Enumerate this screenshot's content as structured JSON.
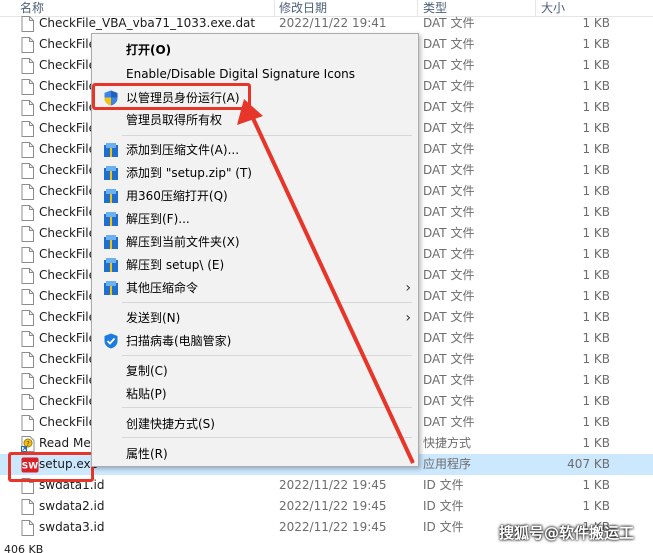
{
  "columns": {
    "name": "名称",
    "date": "修改日期",
    "type": "类型",
    "size": "大小"
  },
  "files": [
    {
      "name": "CheckFile_VBA_vba71_1033.exe.dat",
      "date": "2022/11/22 19:41",
      "type": "DAT 文件",
      "size": "1 KB",
      "icon": "doc-icon"
    },
    {
      "name": "CheckFile",
      "date": "",
      "type": "DAT 文件",
      "size": "1 KB",
      "icon": "doc-icon"
    },
    {
      "name": "CheckFile",
      "date": "",
      "type": "DAT 文件",
      "size": "1 KB",
      "icon": "doc-icon"
    },
    {
      "name": "CheckFile",
      "date": "",
      "type": "DAT 文件",
      "size": "1 KB",
      "icon": "doc-icon"
    },
    {
      "name": "CheckFile",
      "date": "",
      "type": "DAT 文件",
      "size": "1 KB",
      "icon": "doc-icon"
    },
    {
      "name": "CheckFile",
      "date": "",
      "type": "DAT 文件",
      "size": "1 KB",
      "icon": "doc-icon"
    },
    {
      "name": "CheckFile",
      "date": "",
      "type": "DAT 文件",
      "size": "1 KB",
      "icon": "doc-icon"
    },
    {
      "name": "CheckFile",
      "date": "",
      "type": "DAT 文件",
      "size": "1 KB",
      "icon": "doc-icon"
    },
    {
      "name": "CheckFile",
      "date": "",
      "type": "DAT 文件",
      "size": "1 KB",
      "icon": "doc-icon"
    },
    {
      "name": "CheckFile",
      "date": "",
      "type": "DAT 文件",
      "size": "1 KB",
      "icon": "doc-icon"
    },
    {
      "name": "CheckFile",
      "date": "",
      "type": "DAT 文件",
      "size": "1 KB",
      "icon": "doc-icon"
    },
    {
      "name": "CheckFile",
      "date": "",
      "type": "DAT 文件",
      "size": "1 KB",
      "icon": "doc-icon"
    },
    {
      "name": "CheckFile",
      "date": "",
      "type": "DAT 文件",
      "size": "1 KB",
      "icon": "doc-icon"
    },
    {
      "name": "CheckFile",
      "date": "",
      "type": "DAT 文件",
      "size": "1 KB",
      "icon": "doc-icon"
    },
    {
      "name": "CheckFile",
      "date": "",
      "type": "DAT 文件",
      "size": "1 KB",
      "icon": "doc-icon"
    },
    {
      "name": "CheckFile",
      "date": "",
      "type": "DAT 文件",
      "size": "1 KB",
      "icon": "doc-icon"
    },
    {
      "name": "CheckFile",
      "date": "",
      "type": "DAT 文件",
      "size": "1 KB",
      "icon": "doc-icon"
    },
    {
      "name": "CheckFile",
      "date": "",
      "type": "DAT 文件",
      "size": "1 KB",
      "icon": "doc-icon"
    },
    {
      "name": "CheckFile",
      "date": "",
      "type": "DAT 文件",
      "size": "1 KB",
      "icon": "doc-icon"
    },
    {
      "name": "CheckFile",
      "date": "",
      "type": "DAT 文件",
      "size": "1 KB",
      "icon": "doc-icon"
    },
    {
      "name": "Read Me",
      "date": "",
      "type": "快捷方式",
      "size": "1 KB",
      "icon": "shortcut-icon"
    },
    {
      "name": "setup.exe",
      "date": "",
      "type": "应用程序",
      "size": "407 KB",
      "icon": "solidworks-icon",
      "selected": true
    },
    {
      "name": "swdata1.id",
      "date": "2022/11/22 19:45",
      "type": "ID 文件",
      "size": "1 KB",
      "icon": "doc-icon"
    },
    {
      "name": "swdata2.id",
      "date": "2022/11/22 19:45",
      "type": "ID 文件",
      "size": "1 KB",
      "icon": "doc-icon"
    },
    {
      "name": "swdata3.id",
      "date": "2022/11/22 19:45",
      "type": "ID 文件",
      "size": "1 KB",
      "icon": "doc-icon"
    }
  ],
  "status_text": "406 KB",
  "menu": {
    "items": [
      {
        "label": "打开(O)",
        "bold": true,
        "icon": ""
      },
      {
        "label": "Enable/Disable Digital Signature Icons",
        "icon": ""
      },
      {
        "label": "以管理员身份运行(A)",
        "icon": "uac-shield-icon",
        "highlighted": true
      },
      {
        "label": "管理员取得所有权",
        "icon": ""
      },
      {
        "sep": true
      },
      {
        "label": "添加到压缩文件(A)...",
        "icon": "archive-icon"
      },
      {
        "label": "添加到 \"setup.zip\" (T)",
        "icon": "archive-icon"
      },
      {
        "label": "用360压缩打开(Q)",
        "icon": "archive-icon"
      },
      {
        "label": "解压到(F)...",
        "icon": "archive-icon"
      },
      {
        "label": "解压到当前文件夹(X)",
        "icon": "archive-icon"
      },
      {
        "label": "解压到 setup\\ (E)",
        "icon": "archive-icon"
      },
      {
        "label": "其他压缩命令",
        "icon": "archive-icon",
        "submenu": true
      },
      {
        "sep": true
      },
      {
        "label": "发送到(N)",
        "icon": "",
        "submenu": true
      },
      {
        "label": "扫描病毒(电脑管家)",
        "icon": "pc-manager-shield-icon"
      },
      {
        "sep": true
      },
      {
        "label": "复制(C)",
        "icon": ""
      },
      {
        "label": "粘贴(P)",
        "icon": ""
      },
      {
        "sep": true
      },
      {
        "label": "创建快捷方式(S)",
        "icon": ""
      },
      {
        "sep": true
      },
      {
        "label": "属性(R)",
        "icon": ""
      }
    ]
  },
  "watermark": "搜狐号@软件搬运工",
  "colors": {
    "accent_red": "#e8352a",
    "selection": "#cce8ff",
    "menu_bg": "#f2f2f2"
  }
}
